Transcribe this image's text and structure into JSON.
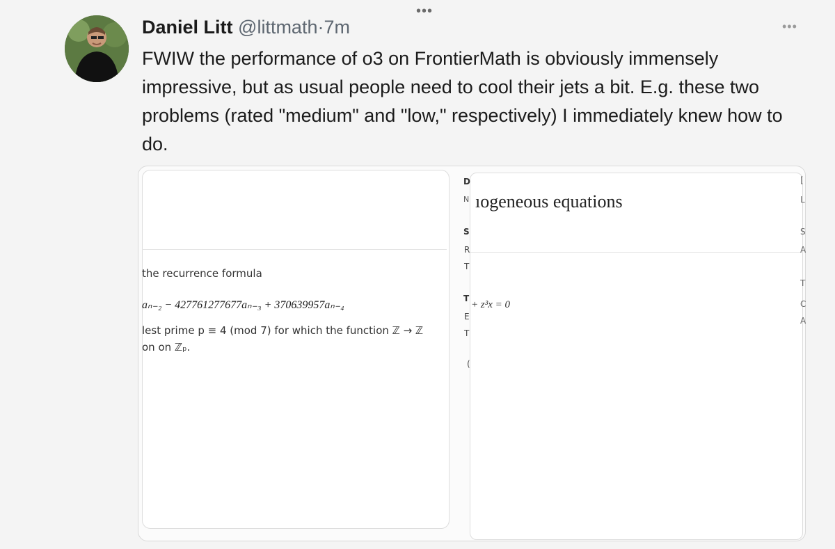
{
  "top_dots": "•••",
  "more_dots": "•••",
  "author": {
    "name": "Daniel Litt",
    "handle": "@littmath",
    "separator": "·",
    "time": "7m"
  },
  "tweet_text": "FWIW the performance of o3 on FrontierMath is obviously immensely impressive, but as usual people need to cool their jets a bit. E.g. these two problems (rated \"medium\" and \"low,\" respectively) I immediately knew how to do.",
  "image_card": {
    "left_panel": {
      "recurrence_label": "the recurrence formula",
      "recurrence_equation": "aₙ₋₂ − 427761277677aₙ₋₃ + 370639957aₙ₋₄",
      "prime_line": "lest prime p ≡ 4 (mod 7) for which the function ℤ → ℤ",
      "prime_line2": "on on ℤₚ."
    },
    "right_panel": {
      "title_fragment": "ıogeneous equations",
      "title_leading_letter": "N",
      "side_letters_left": [
        "D",
        "S",
        "R",
        "T",
        "T",
        "E",
        "T",
        "("
      ],
      "equation_fragment": "+ z³x = 0",
      "side_letters_right": [
        "[",
        "L",
        "S",
        "A",
        "T",
        "C",
        "A"
      ]
    }
  }
}
